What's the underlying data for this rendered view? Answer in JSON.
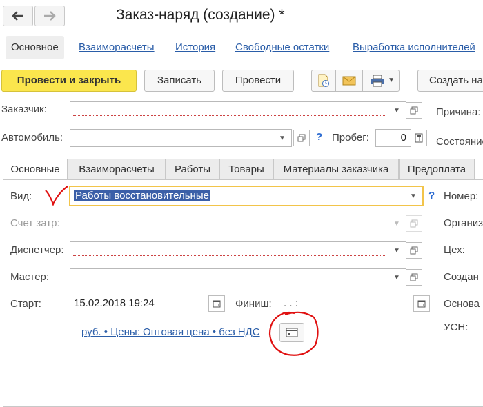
{
  "window": {
    "title": "Заказ-наряд (создание) *"
  },
  "nav_tabs": [
    "Основное",
    "Взаиморасчеты",
    "История",
    "Свободные остатки",
    "Выработка исполнителей"
  ],
  "toolbar": {
    "post_close": "Провести и закрыть",
    "save": "Записать",
    "post": "Провести",
    "create_based": "Создать на"
  },
  "header_fields": {
    "customer_label": "Заказчик:",
    "car_label": "Автомобиль:",
    "mileage_label": "Пробег:",
    "mileage_value": "0",
    "reason_label": "Причина:",
    "state_label": "Состояние"
  },
  "inner_tabs": [
    "Основные",
    "Взаиморасчеты",
    "Работы",
    "Товары",
    "Материалы заказчика",
    "Предоплата"
  ],
  "main": {
    "kind_label": "Вид:",
    "kind_value": "Работы восстановительные",
    "cost_account_label": "Счет затр:",
    "dispatcher_label": "Диспетчер:",
    "master_label": "Мастер:",
    "start_label": "Старт:",
    "start_value": "15.02.2018 19:24",
    "finish_label": "Финиш:",
    "finish_value": ".    .       :",
    "prices_link": "руб. • Цены: Оптовая цена • без НДС",
    "number_label": "Номер:",
    "org_label": "Организ",
    "shop_label": "Цех:",
    "created_label": "Создан",
    "basis_label": "Основа",
    "usn_label": "УСН:"
  },
  "colors": {
    "accent": "#fbe64d",
    "link": "#2a5da8",
    "annotation": "#e01010"
  }
}
